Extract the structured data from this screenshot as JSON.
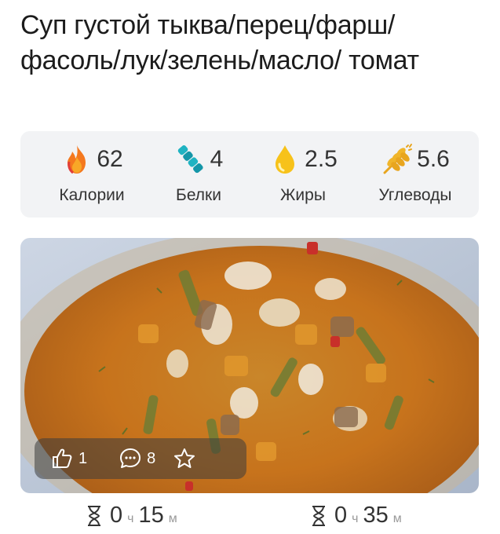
{
  "recipe": {
    "title": "Суп густой тыква/перец/фарш/ фасоль/лук/зелень/масло/ томат"
  },
  "nutrition": [
    {
      "value": "62",
      "label": "Калории",
      "icon": "fire-icon"
    },
    {
      "value": "4",
      "label": "Белки",
      "icon": "protein-helix-icon"
    },
    {
      "value": "2.5",
      "label": "Жиры",
      "icon": "oil-drop-icon"
    },
    {
      "value": "5.6",
      "label": "Углеводы",
      "icon": "wheat-icon"
    }
  ],
  "stats": {
    "likes": "1",
    "comments": "8",
    "like_icon": "thumbs-up-icon",
    "comment_icon": "comment-icon",
    "favorite_icon": "star-icon"
  },
  "times": [
    {
      "hours": "0",
      "h_unit": "ч",
      "minutes": "15",
      "m_unit": "м",
      "icon": "hourglass-icon"
    },
    {
      "hours": "0",
      "h_unit": "ч",
      "minutes": "35",
      "m_unit": "м",
      "icon": "hourglass-icon"
    }
  ],
  "colors": {
    "panel_bg": "#f2f3f5",
    "icon_teal": "#1fa8b8",
    "icon_orange": "#f26a21",
    "icon_yellow": "#f7c21a"
  }
}
